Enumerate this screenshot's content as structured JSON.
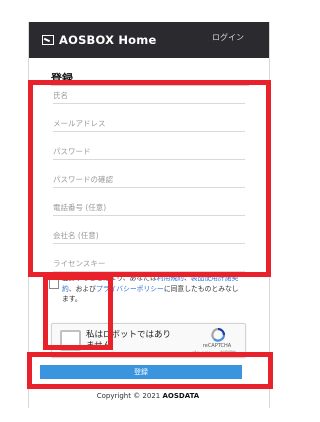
{
  "header": {
    "brand": "AOSBOX Home",
    "login_label": "ログイン"
  },
  "form": {
    "title": "登録",
    "fields": [
      {
        "placeholder": "氏名"
      },
      {
        "placeholder": "メールアドレス"
      },
      {
        "placeholder": "パスワード"
      },
      {
        "placeholder": "パスワードの確認"
      },
      {
        "placeholder": "電話番号 (任意)"
      },
      {
        "placeholder": "会社名 (任意)"
      },
      {
        "placeholder": "ライセンスキー"
      }
    ],
    "consent": {
      "checked": false,
      "text_part1": "登録することにより、あなたは",
      "terms_link": "利用規約",
      "text_part2": "、",
      "privacy_link1": "製品使用許諾契約",
      "text_part3": "、および",
      "privacy_link2": "プライバシーポリシー",
      "text_part4": "に同意したものとみなします。"
    },
    "recaptcha": {
      "label": "私はロボットではありません",
      "brand": "reCAPTCHA",
      "terms": "プライバシー・利用規約"
    },
    "submit_label": "登録"
  },
  "footer": {
    "copyright": "Copyright © 2021",
    "company": "AOSDATA"
  },
  "colors": {
    "header_bg": "#2b2b2f",
    "button_bg": "#3b95de",
    "highlight": "#e8212a",
    "link": "#2a6fd6"
  }
}
